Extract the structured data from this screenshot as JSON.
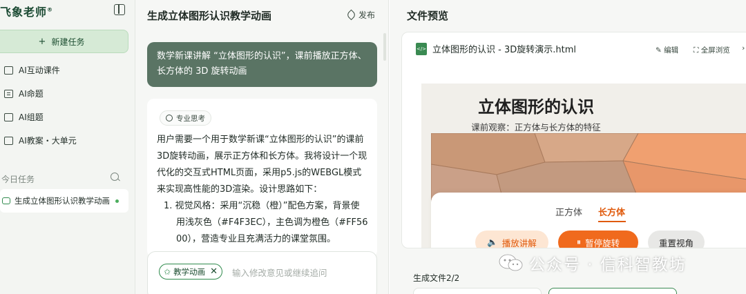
{
  "sidebar": {
    "brand": "飞象老师",
    "brand_mark": "®",
    "new_task_label": "新建任务",
    "nav": [
      {
        "label": "AI互动课件",
        "icon": "interactive-courseware-icon"
      },
      {
        "label": "AI命题",
        "icon": "question-list-icon"
      },
      {
        "label": "AI组题",
        "icon": "image-question-icon"
      },
      {
        "label": "AI教案・大单元",
        "icon": "lesson-plan-icon"
      }
    ],
    "today_label": "今日任务",
    "task": {
      "label": "生成立体图形认识教学动画",
      "status_color": "#4cae5e"
    }
  },
  "chat": {
    "title": "生成立体图形认识教学动画",
    "publish_label": "发布",
    "user_message": "数学新课讲解 “立体图形的认识”，课前播放正方体、长方体的 3D 旋转动画",
    "think_badge": "专业思考",
    "ai_paragraph": "用户需要一个用于数学新课“立体图形的认识”的课前3D旋转动画，展示正方体和长方体。我将设计一个现代化的交互式HTML页面，采用p5.js的WEBGL模式来实现高性能的3D渲染。设计思路如下：",
    "ai_list": [
      "1. 视觉风格：采用“沉稳（橙）”配色方案，背景使用浅灰色（#F4F3EC），主色调为橙色（#FF5600），营造专业且充满活力的课堂氛围。"
    ],
    "input_tag": "教学动画",
    "input_placeholder": "输入修改意见或继续追问"
  },
  "preview": {
    "title": "文件预览",
    "file_name": "立体图形的认识 - 3D旋转演示.html",
    "edit_label": "编辑",
    "fullscreen_label": "全屏浏览",
    "page": {
      "title": "立体图形的认识",
      "subtitle": "课前观察：正方体与长方体的特征",
      "tabs": [
        "正方体",
        "长方体"
      ],
      "active_tab": "长方体",
      "buttons": {
        "audio": "播放讲解",
        "pause": "暂停旋转",
        "reset": "重置视角"
      }
    },
    "generated_label": "生成文件2/2"
  },
  "watermark": "公众号 · 信科智教坊",
  "colors": {
    "accent_green": "#2f8a4c",
    "user_bubble": "#5a7464",
    "orange": "#f06a1d",
    "bg_gray": "#F4F3EC"
  }
}
